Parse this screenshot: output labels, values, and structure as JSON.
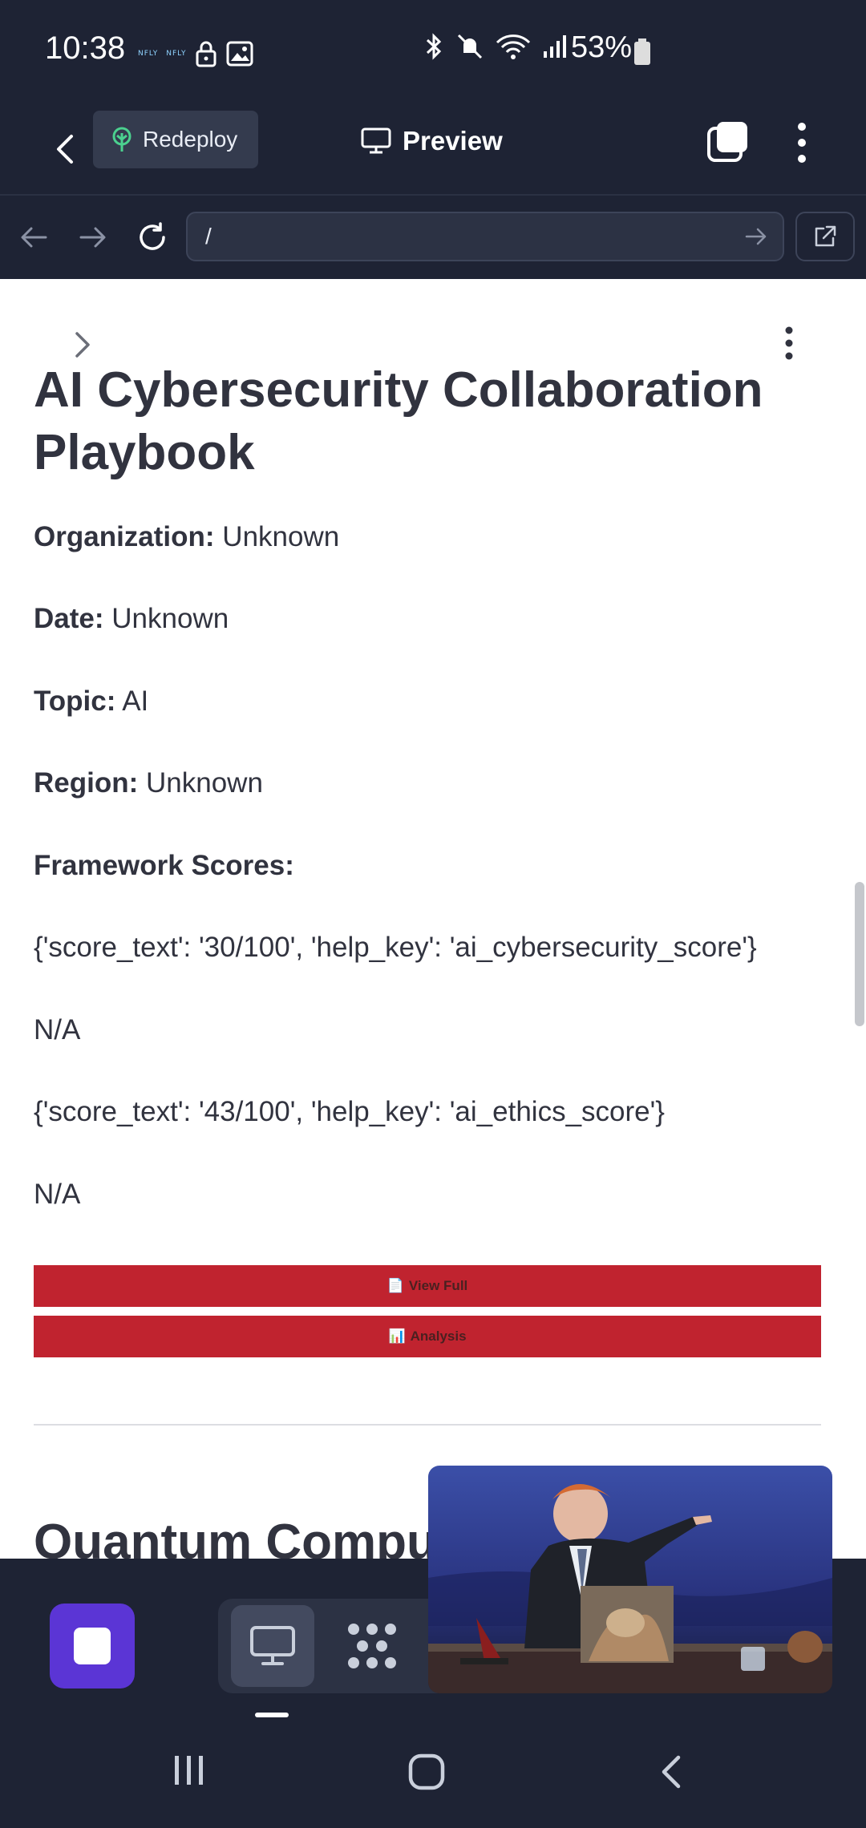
{
  "status_bar": {
    "time": "10:38",
    "app_badge_1": "NFLY",
    "app_badge_2": "NFLY",
    "battery_percent": "53%"
  },
  "app_bar": {
    "redeploy_label": "Redeploy",
    "preview_label": "Preview"
  },
  "url_bar": {
    "value": "/"
  },
  "page": {
    "title": "AI Cybersecurity Collaboration Playbook",
    "fields": [
      {
        "label": "Organization:",
        "value": "Unknown"
      },
      {
        "label": "Date:",
        "value": "Unknown"
      },
      {
        "label": "Topic:",
        "value": "AI"
      },
      {
        "label": "Region:",
        "value": "Unknown"
      }
    ],
    "scores_label": "Framework Scores:",
    "paragraphs": [
      "{'score_text': '30/100', 'help_key': 'ai_cybersecurity_score'}",
      "N/A",
      "{'score_text': '43/100', 'help_key': 'ai_ethics_score'}",
      "N/A"
    ],
    "buttons": [
      {
        "icon": "📄",
        "label": "View Full"
      },
      {
        "icon": "📊",
        "label": "Analysis"
      }
    ],
    "next_heading": "Quantum Comput"
  },
  "colors": {
    "chrome_bg": "#1e2334",
    "accent_purple": "#5b35d5",
    "button_red": "#c0232f",
    "text_dark": "#31333f"
  }
}
